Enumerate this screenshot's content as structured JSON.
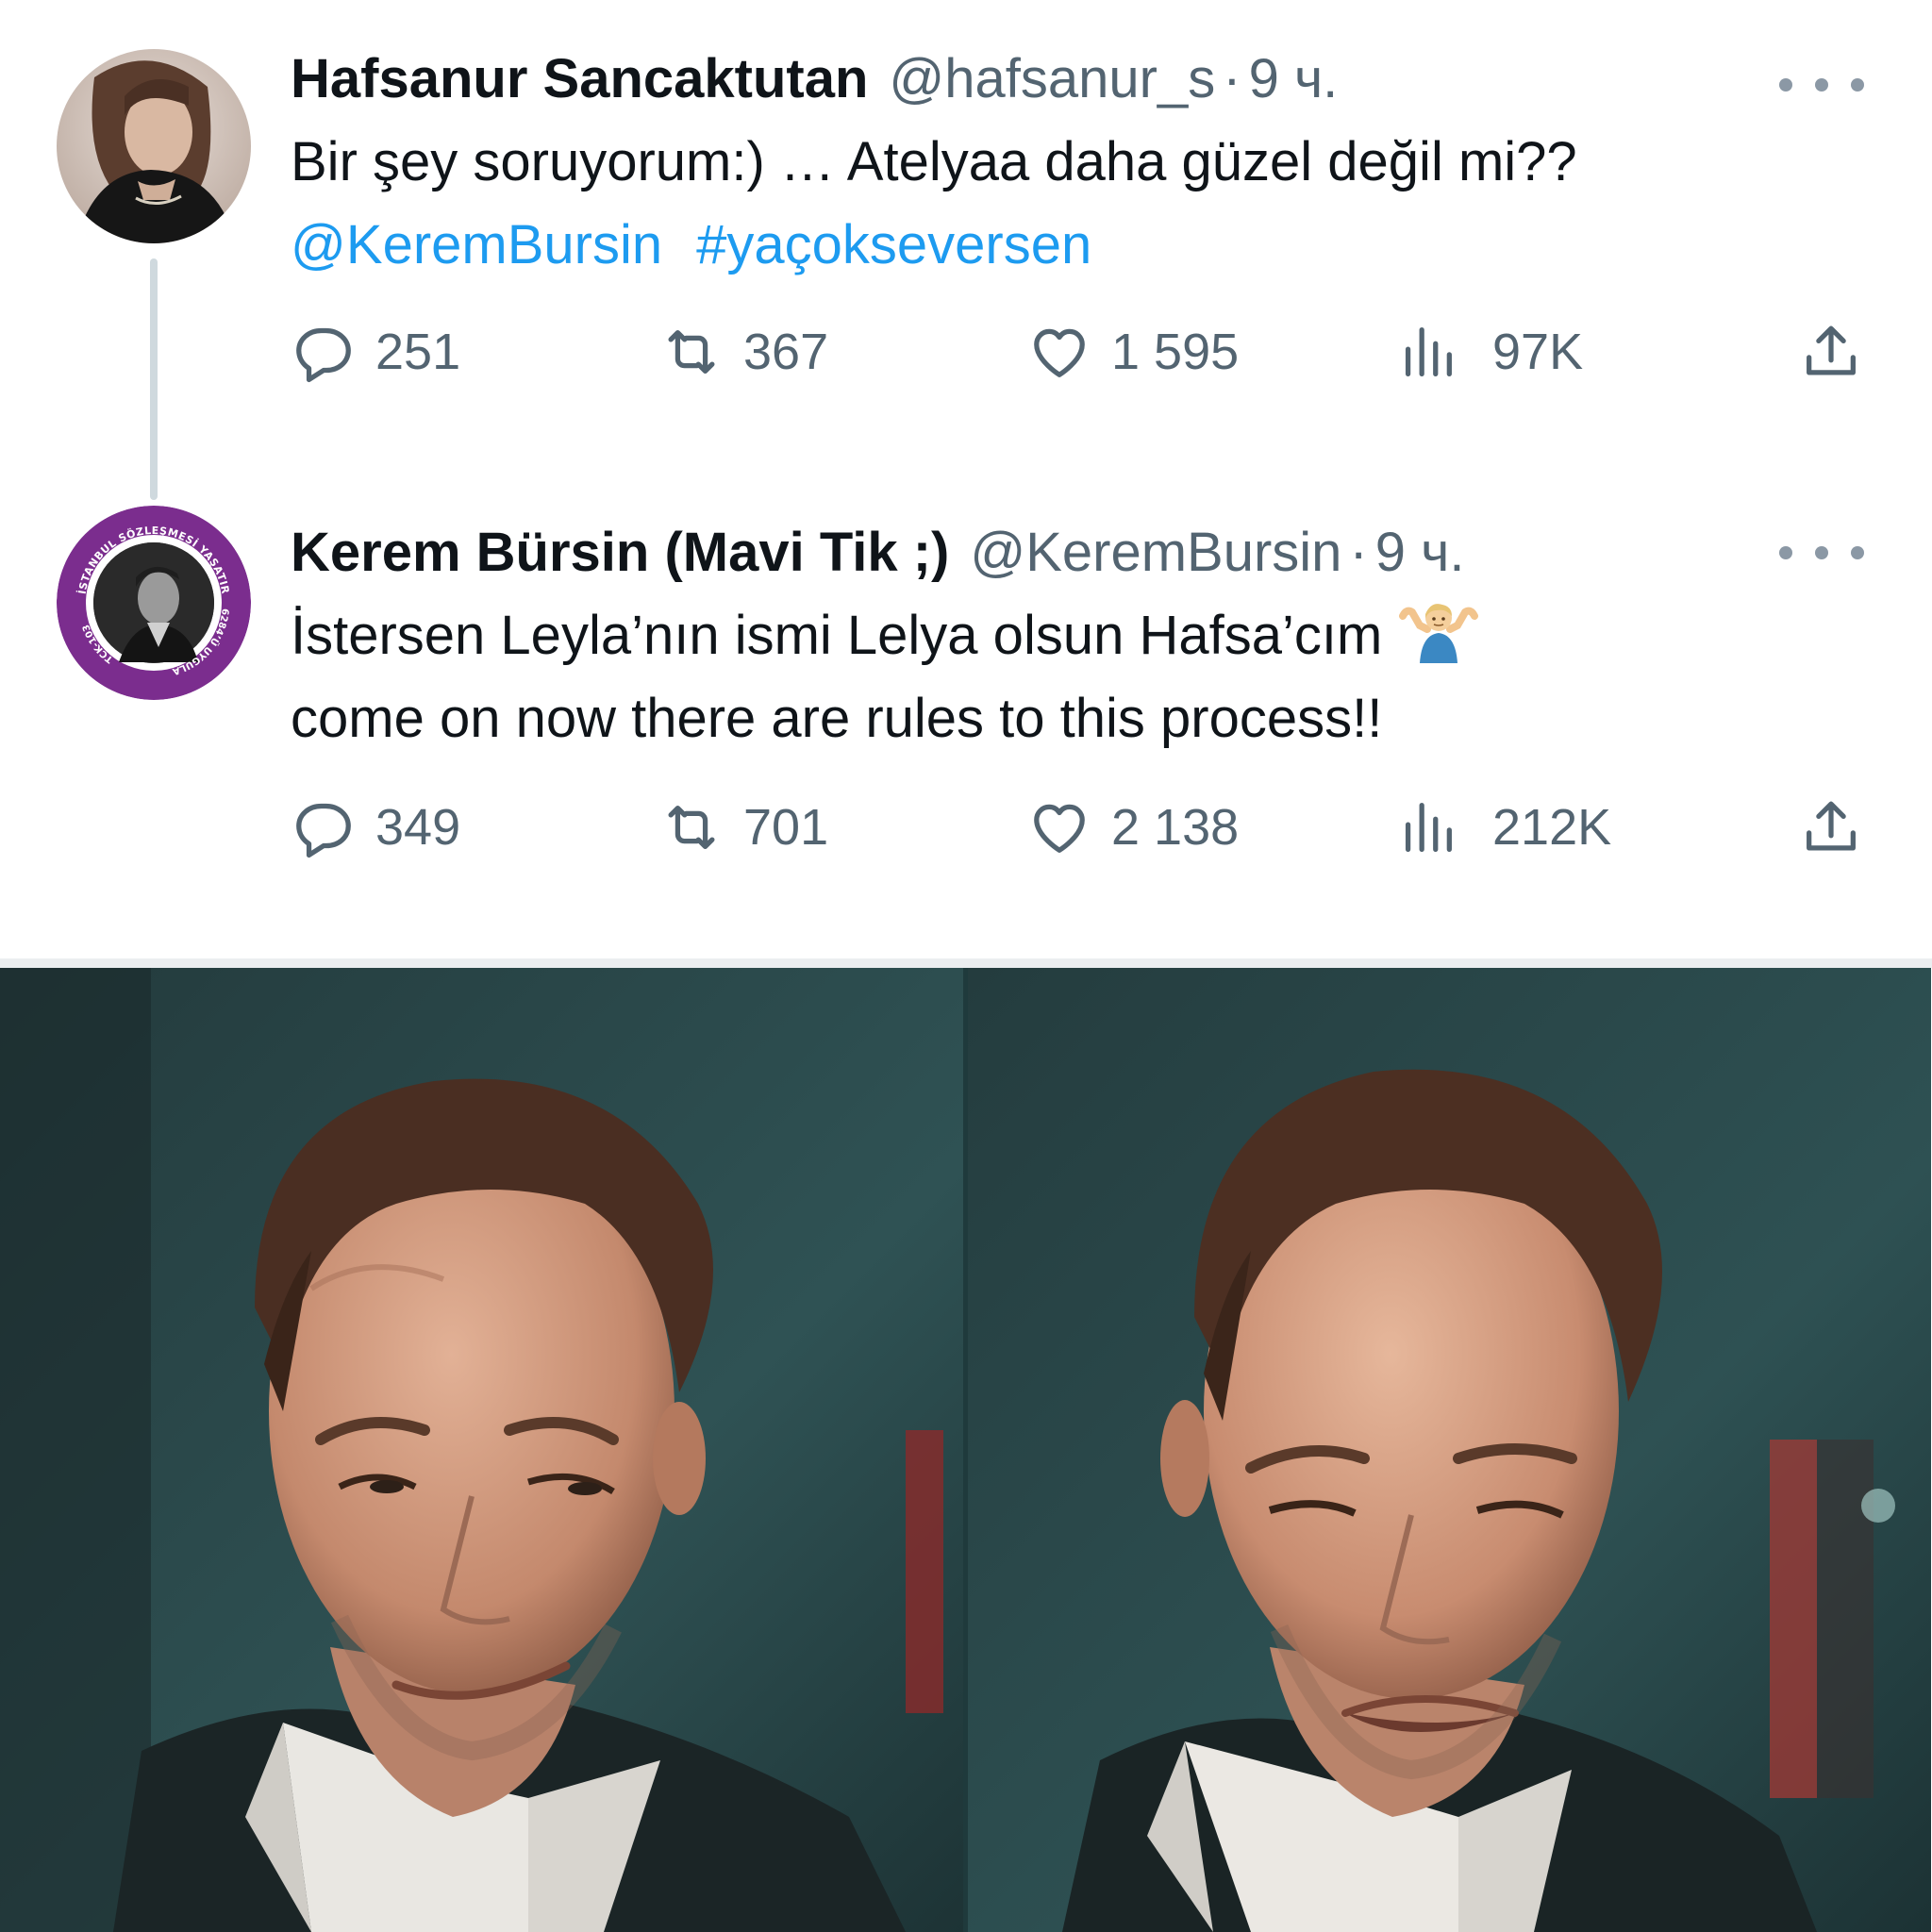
{
  "tweets": [
    {
      "display_name": "Hafsanur Sancaktutan",
      "handle": "@hafsanur_s",
      "separator": "·",
      "time": "9 ч.",
      "text": "Bir şey soruyorum:) … Atelyaa daha güzel değil mi??",
      "mention": "@KeremBursin",
      "hashtag": "#yaçokseversen",
      "replies": "251",
      "retweets": "367",
      "likes": "1 595",
      "views": "97K"
    },
    {
      "display_name": "Kerem Bürsin (Mavi Tik ;)",
      "handle": "@KeremBursin",
      "separator": "·",
      "time": "9 ч.",
      "text_line1": "İstersen Leyla’nın ismi Lelya olsun Hafsa’cım",
      "text_line2": "come on now there are rules to this process!!",
      "avatar_badge": {
        "top_text": "İSTANBUL SÖZLEŞMESİ YAŞATIR",
        "left_text": "TCK-103",
        "right_text": "6284’Ü UYGULA"
      },
      "replies": "349",
      "retweets": "701",
      "likes": "2 138",
      "views": "212K"
    }
  ],
  "icons": {
    "reply": "reply-icon",
    "retweet": "retweet-icon",
    "like": "heart-icon",
    "views": "views-icon",
    "share": "share-icon",
    "more": "more-icon",
    "emoji": "person-shrugging-emoji"
  },
  "colors": {
    "text": "#0f1419",
    "secondary": "#536471",
    "link": "#1d9bf0",
    "badge_purple": "#7b2d8e"
  }
}
